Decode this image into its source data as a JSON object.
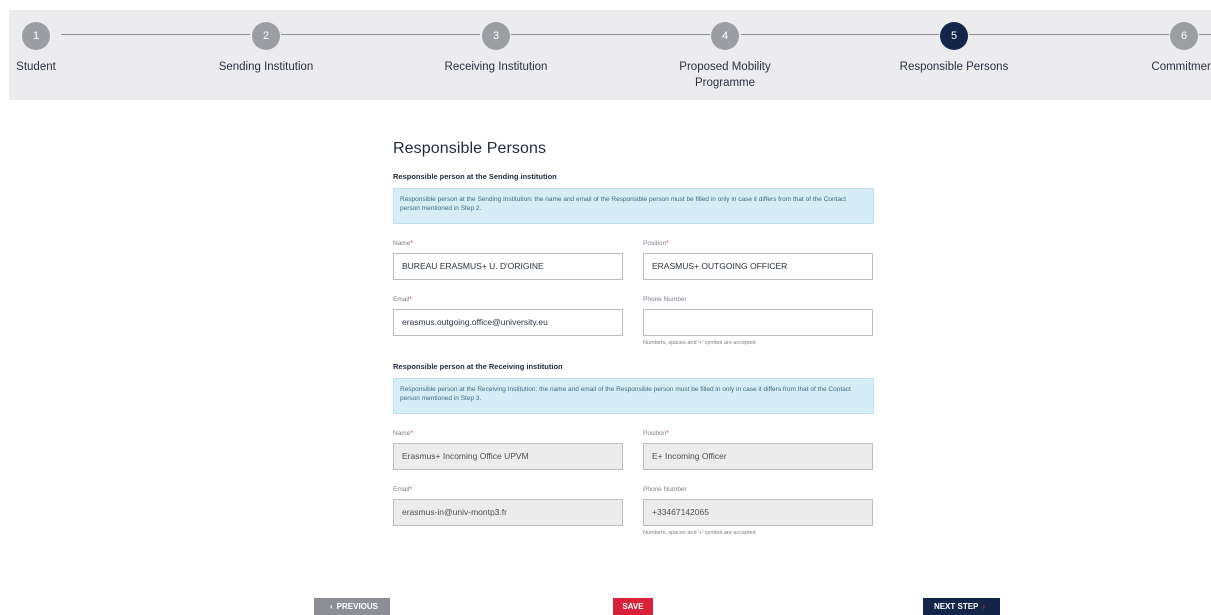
{
  "stepper": {
    "steps": [
      {
        "number": "1",
        "label": "Student"
      },
      {
        "number": "2",
        "label": "Sending Institution"
      },
      {
        "number": "3",
        "label": "Receiving Institution"
      },
      {
        "number": "4",
        "label": "Proposed Mobility Programme"
      },
      {
        "number": "5",
        "label": "Responsible Persons"
      },
      {
        "number": "6",
        "label": "Commitment"
      }
    ],
    "active_step": "5"
  },
  "page": {
    "title": "Responsible Persons"
  },
  "sending": {
    "section_title": "Responsible person at the Sending institution",
    "info": "Responsible person at the Sending Institution: the name and email of the Responsible person must be filled in only in case it differs from that of the Contact person mentioned in Step 2.",
    "name_label": "Name",
    "name_value": "BUREAU ERASMUS+ U. D'ORIGINE",
    "position_label": "Position",
    "position_value": "ERASMUS+ OUTGOING OFFICER",
    "email_label": "Email",
    "email_value": "erasmus.outgoing.office@university.eu",
    "phone_label": "Phone Number",
    "phone_value": "",
    "phone_hint": "Numbers, spaces and '+' symbol are accepted"
  },
  "receiving": {
    "section_title": "Responsible person at the Receiving institution",
    "info": "Responsible person at the Receiving Institution: the name and email of the Responsible person must be filled in only in case it differs from that of the Contact person mentioned in Step 3.",
    "name_label": "Name",
    "name_value": "Erasmus+ Incoming Office UPVM",
    "position_label": "Position",
    "position_value": "E+ Incoming Officer",
    "email_label": "Email",
    "email_value": "erasmus-in@univ-montp3.fr",
    "phone_label": "Phone Number",
    "phone_value": "+33467142065",
    "phone_hint": "Numbers, spaces and '+' symbol are accepted"
  },
  "required_marker": "*",
  "buttons": {
    "previous": "PREVIOUS",
    "save": "SAVE",
    "next": "NEXT STEP"
  },
  "icons": {
    "previous": "chevron-left-icon",
    "next": "chevron-right-icon"
  },
  "colors": {
    "active_step": "#13264a",
    "inactive_step": "#9b9ea3",
    "required": "#d9213a",
    "save": "#d9213a",
    "info_bg": "#d6edf6"
  }
}
